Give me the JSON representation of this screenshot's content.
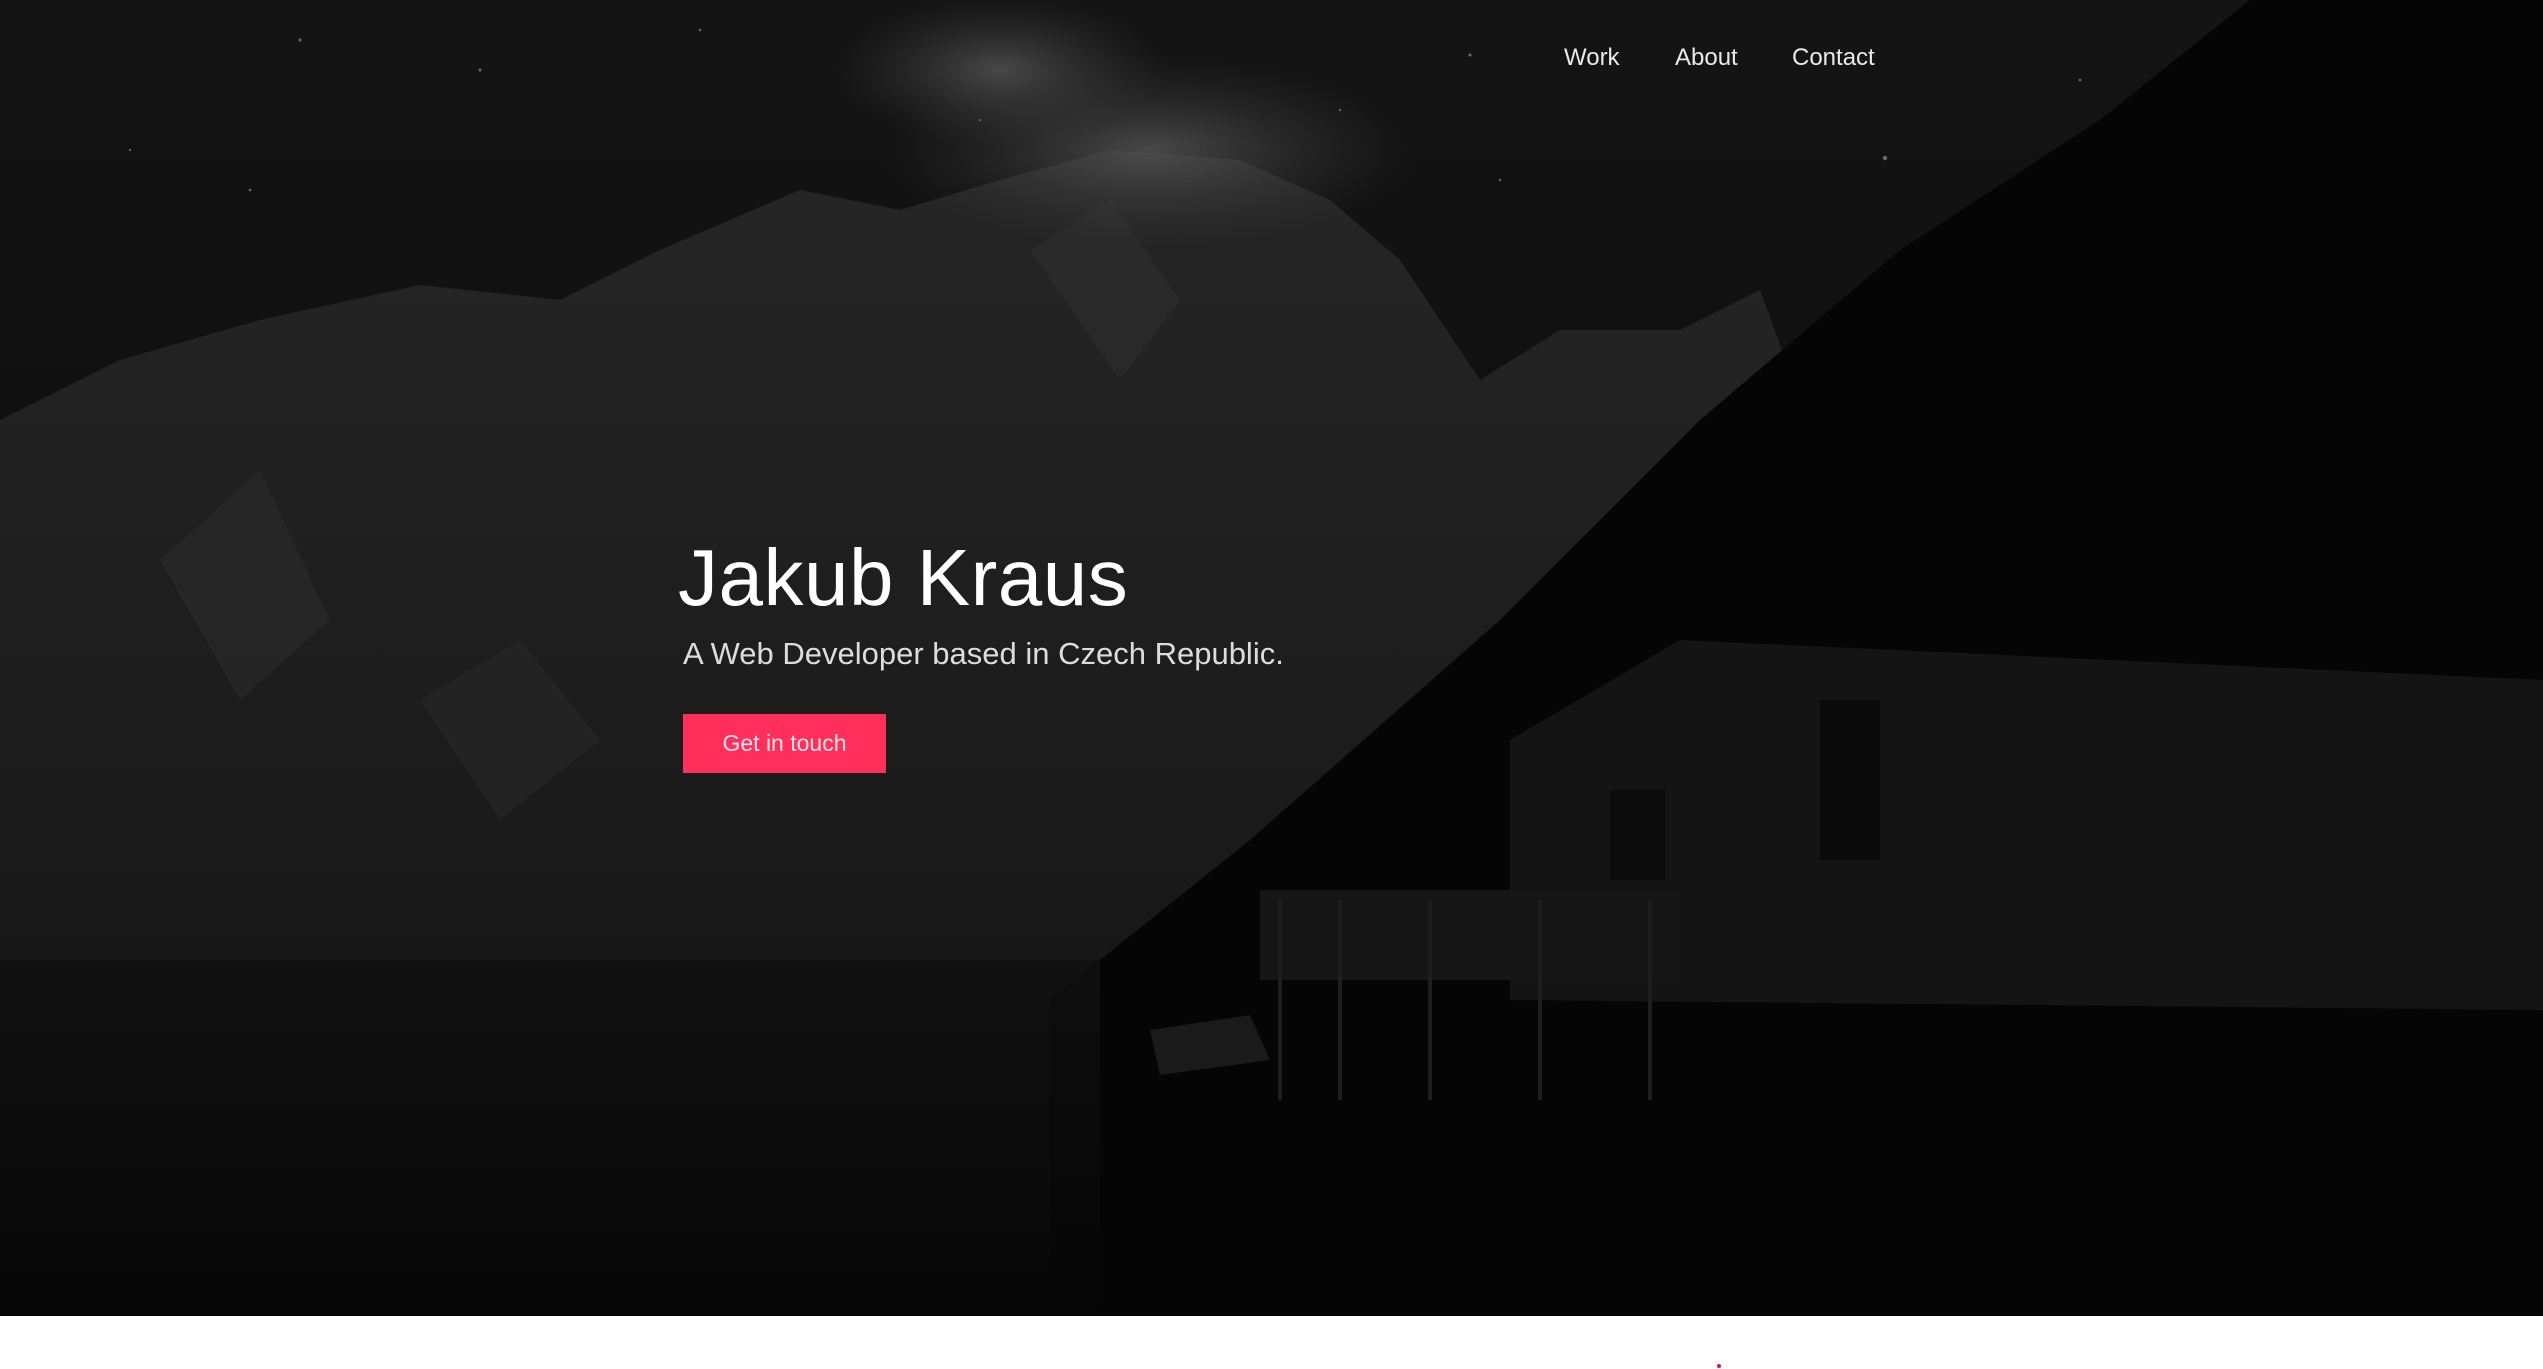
{
  "nav": {
    "items": [
      {
        "label": "Work"
      },
      {
        "label": "About"
      },
      {
        "label": "Contact"
      }
    ]
  },
  "hero": {
    "title": "Jakub Kraus",
    "subtitle": "A Web Developer based in Czech Republic.",
    "cta_label": "Get in touch",
    "background_image": "night-mountain-lake-boathouse"
  },
  "colors": {
    "accent": "#ff2e5b",
    "hero_background": "#080808",
    "page_background": "#ffffff",
    "nav_text": "#e9e9e9",
    "title_text": "#ffffff"
  }
}
